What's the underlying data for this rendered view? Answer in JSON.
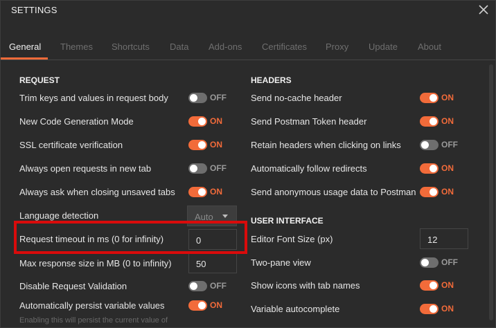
{
  "window": {
    "title": "SETTINGS"
  },
  "tabs": [
    "General",
    "Themes",
    "Shortcuts",
    "Data",
    "Add-ons",
    "Certificates",
    "Proxy",
    "Update",
    "About"
  ],
  "request": {
    "title": "REQUEST",
    "items": [
      {
        "label": "Trim keys and values in request body",
        "state": "OFF"
      },
      {
        "label": "New Code Generation Mode",
        "state": "ON"
      },
      {
        "label": "SSL certificate verification",
        "state": "ON"
      },
      {
        "label": "Always open requests in new tab",
        "state": "OFF"
      },
      {
        "label": "Always ask when closing unsaved tabs",
        "state": "ON"
      }
    ],
    "language_detection": {
      "label": "Language detection",
      "value": "Auto"
    },
    "timeout": {
      "label": "Request timeout in ms (0 for infinity)",
      "value": "0"
    },
    "max_response": {
      "label": "Max response size in MB (0 to infinity)",
      "value": "50"
    },
    "disable_validation": {
      "label": "Disable Request Validation",
      "state": "OFF"
    },
    "persist_vars": {
      "label": "Automatically persist variable values",
      "state": "ON"
    },
    "persist_hint": "Enabling this will persist the current value of"
  },
  "headers": {
    "title": "HEADERS",
    "items": [
      {
        "label": "Send no-cache header",
        "state": "ON"
      },
      {
        "label": "Send Postman Token header",
        "state": "ON"
      },
      {
        "label": "Retain headers when clicking on links",
        "state": "OFF"
      },
      {
        "label": "Automatically follow redirects",
        "state": "ON"
      },
      {
        "label": "Send anonymous usage data to Postman",
        "state": "ON"
      }
    ]
  },
  "ui": {
    "title": "USER INTERFACE",
    "font_size": {
      "label": "Editor Font Size (px)",
      "value": "12"
    },
    "items": [
      {
        "label": "Two-pane view",
        "state": "OFF"
      },
      {
        "label": "Show icons with tab names",
        "state": "ON"
      },
      {
        "label": "Variable autocomplete",
        "state": "ON"
      }
    ]
  },
  "colors": {
    "accent": "#f26b3a",
    "highlight": "#d90b0b",
    "background": "#2b2b2b"
  },
  "icons": {
    "close": "close-icon",
    "dropdown": "chevron-down-icon"
  }
}
